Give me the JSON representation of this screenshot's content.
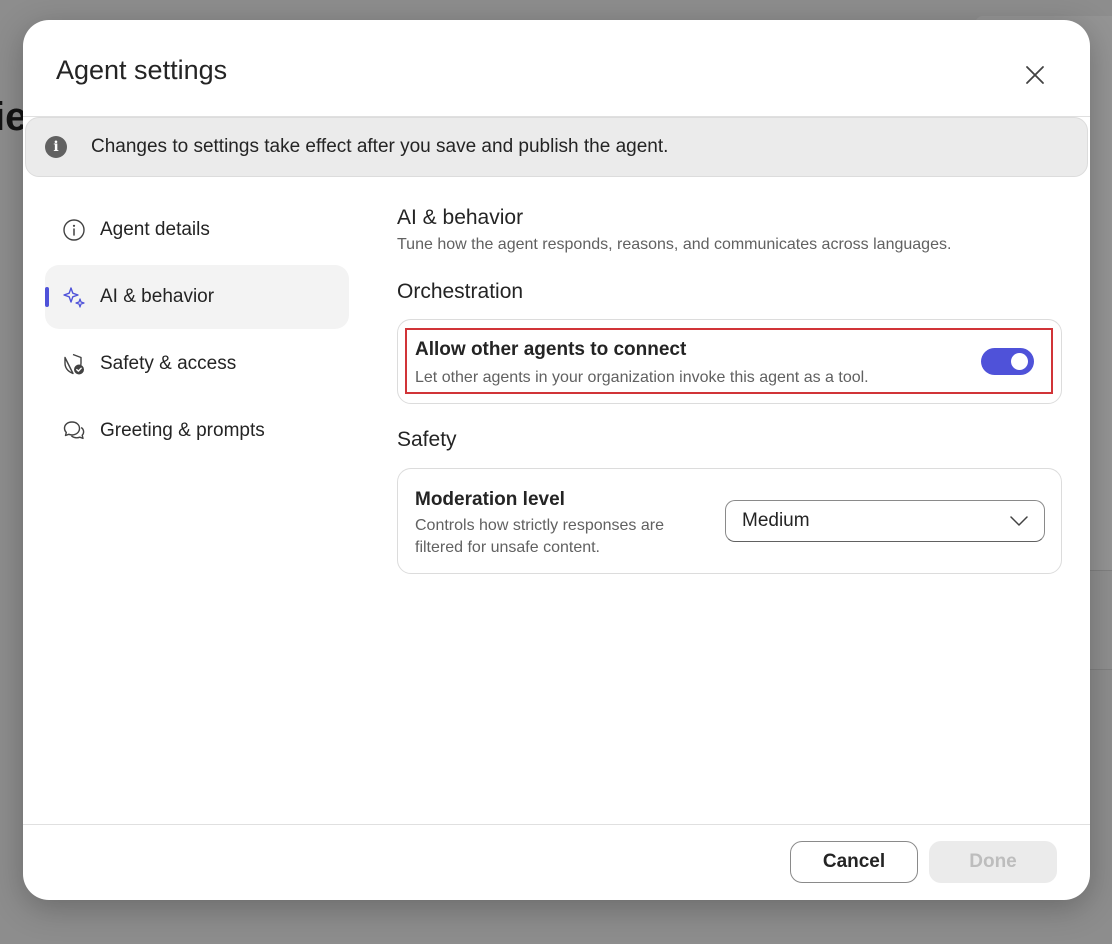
{
  "dialog": {
    "title": "Agent settings",
    "banner": "Changes to settings take effect after you save and publish the agent."
  },
  "nav": {
    "items": [
      {
        "label": "Agent details",
        "icon": "info-icon"
      },
      {
        "label": "AI & behavior",
        "icon": "sparkle-icon",
        "active": true
      },
      {
        "label": "Safety & access",
        "icon": "shield-check-icon"
      },
      {
        "label": "Greeting & prompts",
        "icon": "chat-bubbles-icon"
      }
    ]
  },
  "content": {
    "title": "AI & behavior",
    "subtitle": "Tune how the agent responds, reasons, and communicates across languages.",
    "orchestration": {
      "heading": "Orchestration",
      "setting_title": "Allow other agents to connect",
      "setting_desc": "Let other agents in your organization invoke this agent as a tool.",
      "toggle_on": true
    },
    "safety": {
      "heading": "Safety",
      "setting_title": "Moderation level",
      "setting_desc_line1": "Controls how strictly responses are",
      "setting_desc_line2": "filtered for unsafe content.",
      "selected": "Medium"
    }
  },
  "footer": {
    "cancel": "Cancel",
    "done": "Done"
  },
  "colors": {
    "accent": "#4f52d9",
    "highlight": "#d13438"
  }
}
